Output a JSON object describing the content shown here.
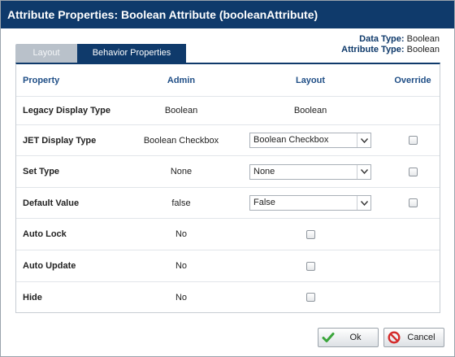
{
  "dialog": {
    "title": "Attribute Properties: Boolean Attribute (booleanAttribute)"
  },
  "meta": {
    "data_type_label": "Data Type:",
    "data_type_value": "Boolean",
    "attribute_type_label": "Attribute Type:",
    "attribute_type_value": "Boolean"
  },
  "tabs": [
    {
      "label": "Layout",
      "active": false
    },
    {
      "label": "Behavior Properties",
      "active": true
    }
  ],
  "table": {
    "headers": {
      "property": "Property",
      "admin": "Admin",
      "layout": "Layout",
      "override": "Override"
    },
    "rows": [
      {
        "property": "Legacy Display Type",
        "admin": "Boolean",
        "layout": "Boolean"
      },
      {
        "property": "JET Display Type",
        "admin": "Boolean Checkbox",
        "layout_select": "Boolean Checkbox",
        "override_checked": false
      },
      {
        "property": "Set Type",
        "admin": "None",
        "layout_select": "None",
        "override_checked": false
      },
      {
        "property": "Default Value",
        "admin": "false",
        "layout_select": "False",
        "override_checked": false
      },
      {
        "property": "Auto Lock",
        "admin": "No",
        "layout_checked": false
      },
      {
        "property": "Auto Update",
        "admin": "No",
        "layout_checked": false
      },
      {
        "property": "Hide",
        "admin": "No",
        "layout_checked": false
      }
    ]
  },
  "buttons": {
    "ok_label": "Ok",
    "cancel_label": "Cancel"
  },
  "colors": {
    "title_bar": "#0f3a6b",
    "header_text": "#1f4e86",
    "ok_icon": "#3aa53a",
    "cancel_icon": "#d42a2a"
  },
  "icons": {
    "ok": "checkmark-icon",
    "cancel": "no-entry-icon",
    "dropdown": "chevron-down-icon"
  }
}
